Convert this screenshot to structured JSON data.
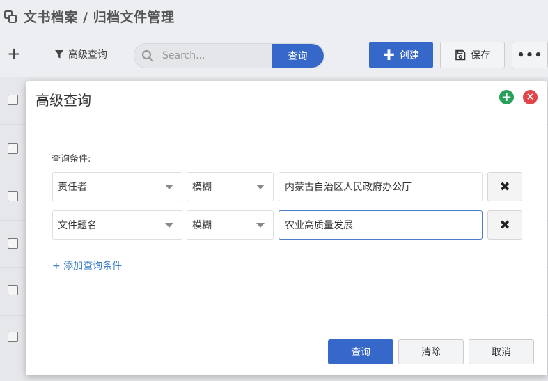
{
  "header": {
    "title": "文书档案 / 归档文件管理",
    "title_icon": "swap-icon"
  },
  "toolbar": {
    "add_glyph": "+",
    "advanced_query_label": "高级查询",
    "search_placeholder": "Search...",
    "search_button_label": "查询",
    "create_label": "创建",
    "save_label": "保存",
    "more_label": "•••",
    "accent_color": "#3568c9"
  },
  "modal": {
    "title": "高级查询",
    "add_glyph": "+",
    "close_glyph": "×",
    "condition_label": "查询条件:",
    "conditions": [
      {
        "field": "责任者",
        "operator": "模糊",
        "value": "内蒙古自治区人民政府办公厅"
      },
      {
        "field": "文件题名",
        "operator": "模糊",
        "value": "农业高质量发展"
      }
    ],
    "delete_glyph": "✖",
    "add_condition_label": "+ 添加查询条件",
    "buttons": {
      "query": "查询",
      "clear": "清除",
      "cancel": "取消"
    }
  }
}
